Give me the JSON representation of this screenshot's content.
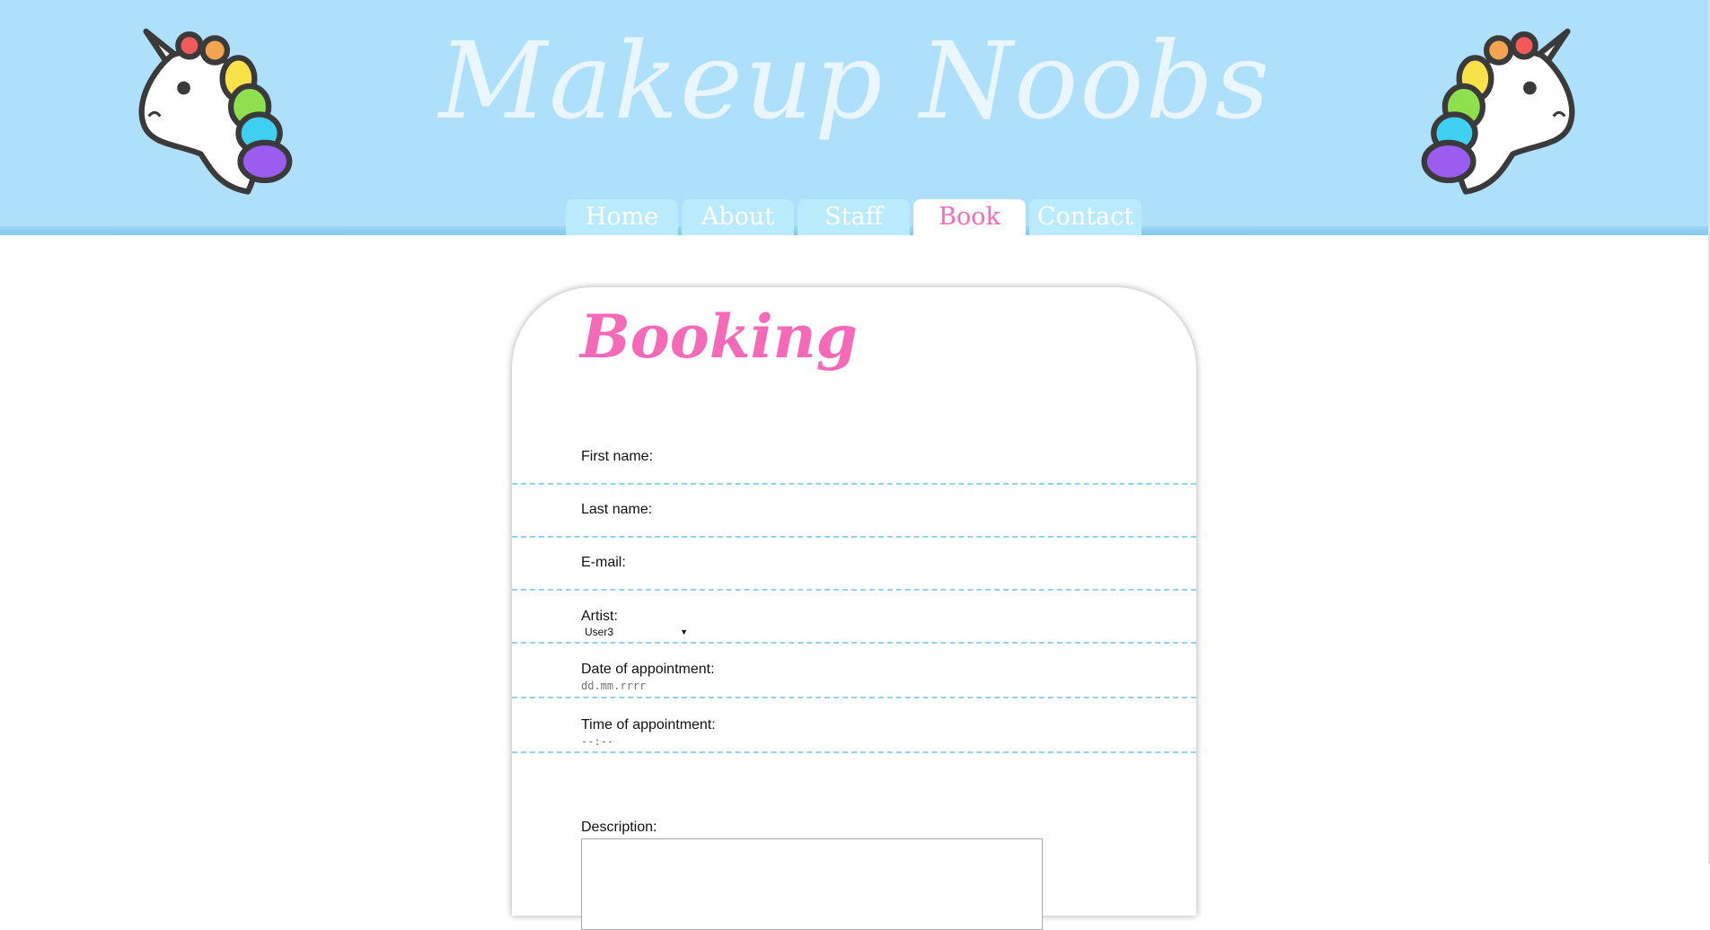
{
  "header": {
    "site_title": "Makeup Noobs",
    "unicorn_left": "unicorn-mascot",
    "unicorn_right": "unicorn-mascot"
  },
  "nav": {
    "tabs": [
      {
        "label": "Home"
      },
      {
        "label": "About"
      },
      {
        "label": "Staff"
      },
      {
        "label": "Book",
        "active": true
      },
      {
        "label": "Contact"
      }
    ]
  },
  "booking": {
    "title": "Booking",
    "first_name_label": "First name:",
    "last_name_label": "Last name:",
    "email_label": "E-mail:",
    "artist_label": "Artist:",
    "artist_selected": "User3",
    "date_label": "Date of appointment:",
    "date_placeholder": "dd.mm.rrrr",
    "time_label": "Time of appointment:",
    "time_placeholder": "--:--",
    "description_label": "Description:"
  },
  "colors": {
    "header_bg": "#aee0fc",
    "accent_pink": "#f56ab8",
    "dash_line": "#8fd3f2",
    "tab_bg": "#b9ebfc"
  }
}
